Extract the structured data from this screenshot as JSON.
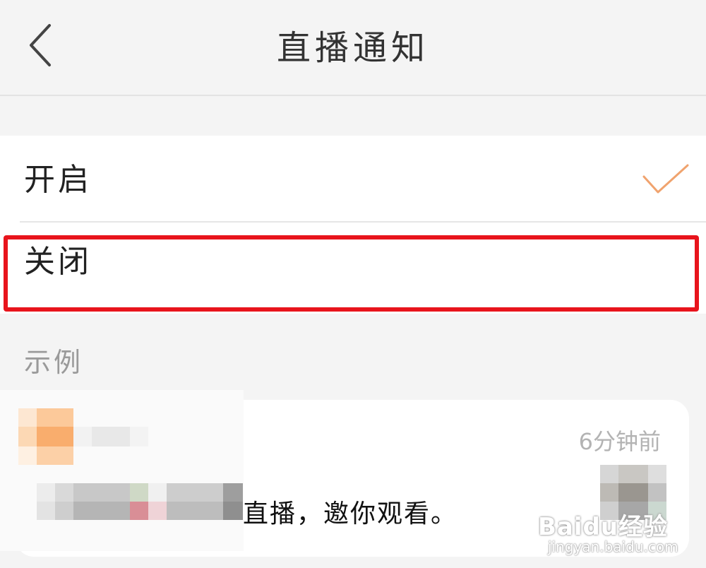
{
  "header": {
    "title": "直播通知",
    "back_icon": "chevron-left-icon"
  },
  "options": [
    {
      "label": "开启",
      "selected": true
    },
    {
      "label": "关闭",
      "selected": false
    }
  ],
  "check_color": "#f0a36e",
  "highlight_color": "#e8141c",
  "example": {
    "section_label": "示例",
    "time": "6分钟前",
    "message_visible": "直播，邀你观看。"
  },
  "watermark": {
    "logo": "Baidu经验",
    "url": "jingyan.baidu.com"
  }
}
